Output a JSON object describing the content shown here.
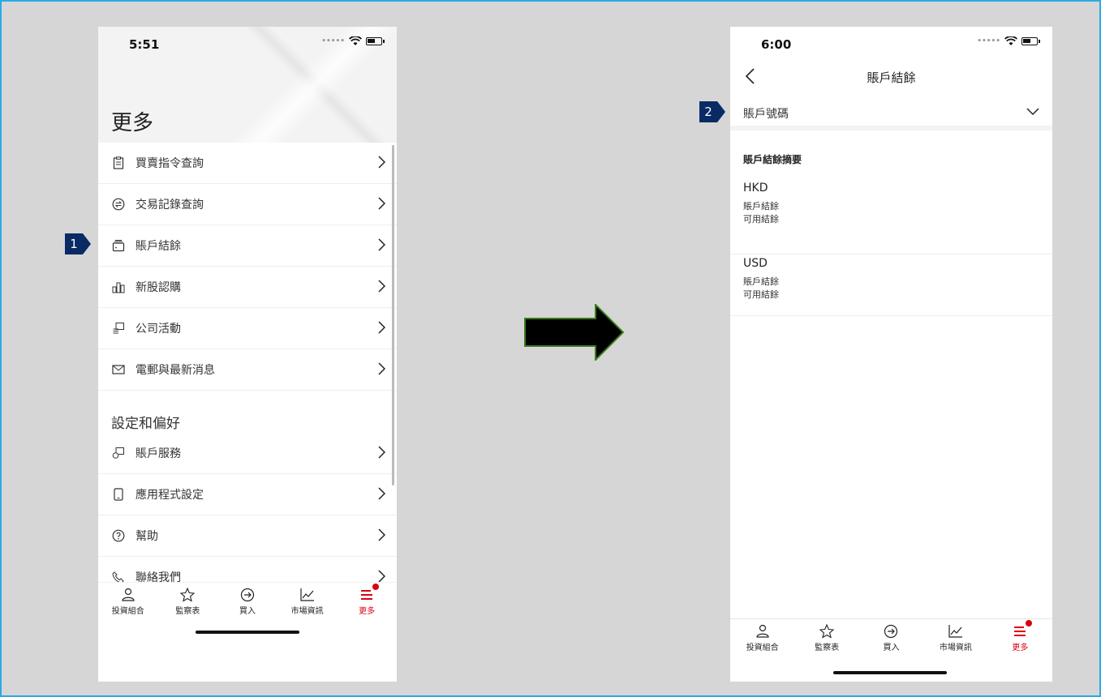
{
  "phone1": {
    "status_time": "5:51",
    "title": "更多",
    "items": [
      {
        "icon": "clipboard-icon",
        "label": "買賣指令查詢"
      },
      {
        "icon": "exchange-icon",
        "label": "交易記錄查詢"
      },
      {
        "icon": "wallet-icon",
        "label": "賬戶結餘"
      },
      {
        "icon": "ipo-chart-icon",
        "label": "新股認購"
      },
      {
        "icon": "corporate-action-icon",
        "label": "公司活動"
      },
      {
        "icon": "envelope-icon",
        "label": "電郵與最新消息"
      }
    ],
    "section_title": "設定和偏好",
    "settings_items": [
      {
        "icon": "account-service-icon",
        "label": "賬戶服務"
      },
      {
        "icon": "phone-icon",
        "label": "應用程式設定"
      },
      {
        "icon": "help-icon",
        "label": "幫助"
      },
      {
        "icon": "contact-icon",
        "label": "聯絡我們"
      }
    ]
  },
  "phone2": {
    "status_time": "6:00",
    "title": "賬戶結餘",
    "account_label": "賬戶號碼",
    "summary_title": "賬戶結餘摘要",
    "currencies": [
      {
        "code": "HKD",
        "balance_label": "賬戶結餘",
        "available_label": "可用結餘"
      },
      {
        "code": "USD",
        "balance_label": "賬戶結餘",
        "available_label": "可用結餘"
      }
    ]
  },
  "tabs": [
    {
      "icon": "portfolio-icon",
      "label": "投資組合"
    },
    {
      "icon": "star-icon",
      "label": "監察表"
    },
    {
      "icon": "buy-icon",
      "label": "買入"
    },
    {
      "icon": "market-chart-icon",
      "label": "市場資訊"
    },
    {
      "icon": "menu-icon",
      "label": "更多"
    }
  ],
  "steps": [
    "1",
    "2"
  ],
  "colors": {
    "accent_red": "#db0011",
    "badge_navy": "#0a2a66",
    "arrow_green": "#3a7d1e",
    "frame_blue": "#29abe2"
  }
}
